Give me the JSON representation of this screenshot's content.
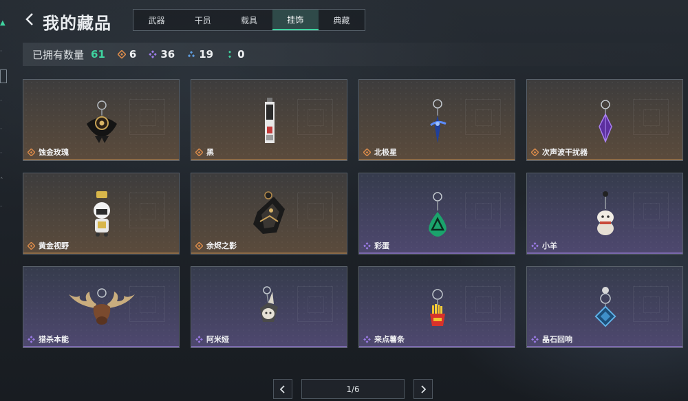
{
  "header": {
    "title": "我的藏品"
  },
  "tabs": [
    {
      "label": "武器"
    },
    {
      "label": "干员"
    },
    {
      "label": "载具"
    },
    {
      "label": "挂饰",
      "active": true
    },
    {
      "label": "典藏"
    }
  ],
  "stats": {
    "label": "已拥有数量",
    "total": "61",
    "counts": [
      {
        "icon": "gold-rarity-icon",
        "color": "#d98a4a",
        "value": "6"
      },
      {
        "icon": "purple-rarity-icon",
        "color": "#9b7be6",
        "value": "36"
      },
      {
        "icon": "blue-rarity-icon",
        "color": "#5f9ee0",
        "value": "19"
      },
      {
        "icon": "green-rarity-icon",
        "color": "#3fd4a0",
        "value": "0"
      }
    ]
  },
  "items": [
    {
      "name": "蚀金玫瑰",
      "rarity": "gold",
      "icon": "gold-rose-charm-icon"
    },
    {
      "name": "黑",
      "rarity": "gold",
      "icon": "black-tag-charm-icon"
    },
    {
      "name": "北极星",
      "rarity": "gold",
      "icon": "polaris-charm-icon"
    },
    {
      "name": "次声波干扰器",
      "rarity": "gold",
      "icon": "purple-crystal-charm-icon"
    },
    {
      "name": "黄金视野",
      "rarity": "gold",
      "icon": "chibi-figure-charm-icon"
    },
    {
      "name": "余烬之影",
      "rarity": "gold",
      "icon": "ember-shadow-charm-icon"
    },
    {
      "name": "彩蛋",
      "rarity": "purple",
      "icon": "green-egg-charm-icon"
    },
    {
      "name": "小羊",
      "rarity": "purple",
      "icon": "lamb-charm-icon"
    },
    {
      "name": "猎杀本能",
      "rarity": "purple",
      "icon": "moose-head-charm-icon"
    },
    {
      "name": "阿米娅",
      "rarity": "purple",
      "icon": "amiya-charm-icon"
    },
    {
      "name": "来点薯条",
      "rarity": "purple",
      "icon": "fries-charm-icon"
    },
    {
      "name": "晶石回响",
      "rarity": "purple",
      "icon": "blue-crystal-charm-icon"
    }
  ],
  "pagination": {
    "page": "1/6"
  }
}
